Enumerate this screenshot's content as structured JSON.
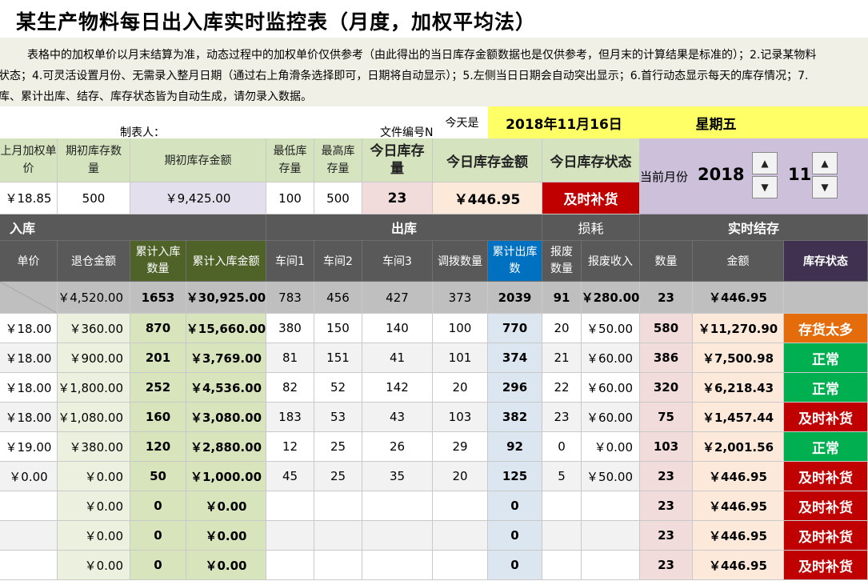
{
  "title": "某生产物料每日出入库实时监控表（月度，加权平均法）",
  "notes": [
    "表格中的加权单价以月末结算为准，动态过程中的加权单价仅供参考（由此得出的当日库存金额数据也是仅供参考，但月末的计算结果是标准的）；2.记录某物料",
    "状态；4.可灵活设置月份、无需录入整月日期（通过右上角滑条选择即可，日期将自动显示）；5.左侧当日日期会自动突出显示；6.首行动态显示每天的库存情况；7.",
    "库、累计出库、结存、库存状态皆为自动生成，请勿录入数据。"
  ],
  "meta": {
    "maker_label": "制表人：",
    "doc_no_label": "文件编号N",
    "today_label": "今天是",
    "today_date": "2018年11月16日",
    "weekday": "星期五",
    "current_month_label": "当前月份",
    "year": "2018",
    "month": "11"
  },
  "summary": {
    "headers": {
      "last_price": "上月加权单价",
      "opening_qty": "期初库存数量",
      "opening_amt": "期初库存金额",
      "min_stock": "最低库存量",
      "max_stock": "最高库存量",
      "today_qty": "今日库存量",
      "today_amt": "今日库存金额",
      "today_status": "今日库存状态"
    },
    "values": {
      "last_price": "￥18.85",
      "opening_qty": "500",
      "opening_amt": "￥9,425.00",
      "min_stock": "100",
      "max_stock": "500",
      "today_qty": "23",
      "today_amt": "￥446.95",
      "today_status": "及时补货"
    }
  },
  "sections": {
    "in": "入库",
    "out": "出库",
    "loss": "损耗",
    "balance": "实时结存"
  },
  "columns": [
    "单价",
    "退仓金额",
    "累计入库数量",
    "累计入库金额",
    "车间1",
    "车间2",
    "车间3",
    "调拨数量",
    "累计出库数",
    "报废数量",
    "报废收入",
    "数量",
    "金额",
    "库存状态"
  ],
  "totals": [
    "",
    "￥4,520.00",
    "1653",
    "￥30,925.00",
    "783",
    "456",
    "427",
    "373",
    "2039",
    "91",
    "￥280.00",
    "23",
    "￥446.95",
    ""
  ],
  "rows": [
    [
      "￥18.00",
      "￥360.00",
      "870",
      "￥15,660.00",
      "380",
      "150",
      "140",
      "100",
      "770",
      "20",
      "￥50.00",
      "580",
      "￥11,270.90",
      "存货太多"
    ],
    [
      "￥18.00",
      "￥900.00",
      "201",
      "￥3,769.00",
      "81",
      "151",
      "41",
      "101",
      "374",
      "21",
      "￥60.00",
      "386",
      "￥7,500.98",
      "正常"
    ],
    [
      "￥18.00",
      "￥1,800.00",
      "252",
      "￥4,536.00",
      "82",
      "52",
      "142",
      "20",
      "296",
      "22",
      "￥60.00",
      "320",
      "￥6,218.43",
      "正常"
    ],
    [
      "￥18.00",
      "￥1,080.00",
      "160",
      "￥3,080.00",
      "183",
      "53",
      "43",
      "103",
      "382",
      "23",
      "￥60.00",
      "75",
      "￥1,457.44",
      "及时补货"
    ],
    [
      "￥19.00",
      "￥380.00",
      "120",
      "￥2,880.00",
      "12",
      "25",
      "26",
      "29",
      "92",
      "0",
      "￥0.00",
      "103",
      "￥2,001.56",
      "正常"
    ],
    [
      "￥0.00",
      "￥0.00",
      "50",
      "￥1,000.00",
      "45",
      "25",
      "35",
      "20",
      "125",
      "5",
      "￥50.00",
      "23",
      "￥446.95",
      "及时补货"
    ],
    [
      "",
      "￥0.00",
      "0",
      "￥0.00",
      "",
      "",
      "",
      "",
      "0",
      "",
      "",
      "23",
      "￥446.95",
      "及时补货"
    ],
    [
      "",
      "￥0.00",
      "0",
      "￥0.00",
      "",
      "",
      "",
      "",
      "0",
      "",
      "",
      "23",
      "￥446.95",
      "及时补货"
    ],
    [
      "",
      "￥0.00",
      "0",
      "￥0.00",
      "",
      "",
      "",
      "",
      "0",
      "",
      "",
      "23",
      "￥446.95",
      "及时补货"
    ]
  ],
  "status_colors": {
    "存货太多": "#e46c0a",
    "正常": "#00b050",
    "及时补货": "#c00000"
  },
  "colors": {
    "header_green": "#d5e4bf",
    "today_yellow": "#ffff66",
    "month_panel": "#ccc0da",
    "today_status_red": "#c00000"
  }
}
